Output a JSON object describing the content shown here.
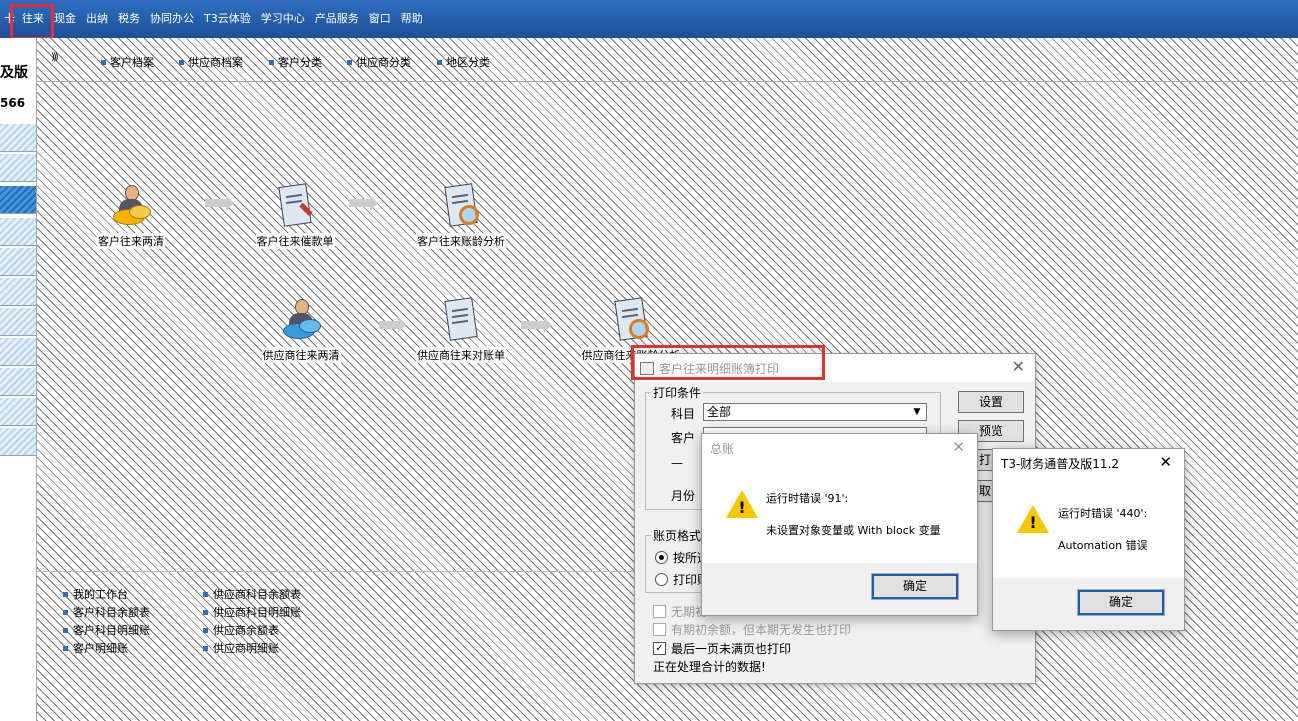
{
  "menu": {
    "items": [
      "卡",
      "往来",
      "现金",
      "出纳",
      "税务",
      "协同办公",
      "T3云体验",
      "学习中心",
      "产品服务",
      "窗口",
      "帮助"
    ]
  },
  "left_panel": {
    "title": "及版",
    "code": "566"
  },
  "toolbar": {
    "items": [
      "客户档案",
      "供应商档案",
      "客户分类",
      "供应商分类",
      "地区分类"
    ]
  },
  "flow": {
    "nodes": [
      {
        "label": "客户往来两清",
        "icon": "customer-clearing-icon"
      },
      {
        "label": "客户往来催款单",
        "icon": "customer-dunning-icon"
      },
      {
        "label": "客户往来账龄分析",
        "icon": "customer-aging-icon"
      },
      {
        "label": "供应商往来两清",
        "icon": "supplier-clearing-icon"
      },
      {
        "label": "供应商往来对账单",
        "icon": "supplier-statement-icon"
      },
      {
        "label": "供应商往来账龄分析",
        "icon": "supplier-aging-icon"
      }
    ]
  },
  "links": {
    "col1": [
      "我的工作台",
      "客户科目余额表",
      "客户科目明细账",
      "客户明细账"
    ],
    "col2": [
      "供应商科目余额表",
      "供应商科目明细账",
      "供应商余额表",
      "供应商明细账"
    ]
  },
  "print_dialog": {
    "title": "客户往来明细账簿打印",
    "group_conditions": "打印条件",
    "label_subject": "科目",
    "subject_value": "全部",
    "label_customer": "客户",
    "customer_value": "",
    "dash": "—",
    "label_month": "月份",
    "buttons": {
      "settings": "设置",
      "preview": "预览",
      "print": "打印",
      "cancel": "取消"
    },
    "group_format": "账页格式",
    "radio_1": "按所选",
    "radio_2": "打印账",
    "check_1": "无期初",
    "check_2": "有期初余额，但本期无发生也打印",
    "check_3": "最后一页未满页也打印",
    "status": "正在处理合计的数据!"
  },
  "msg_general_ledger": {
    "title": "总账",
    "line1": "运行时错误 '91':",
    "line2": "未设置对象变量或 With block 变量",
    "ok": "确定",
    "close": "✕"
  },
  "msg_t3": {
    "title": "T3-财务通普及版11.2",
    "line1": "运行时错误 '440':",
    "line2": "Automation 错误",
    "ok": "确定",
    "close": "✕"
  }
}
